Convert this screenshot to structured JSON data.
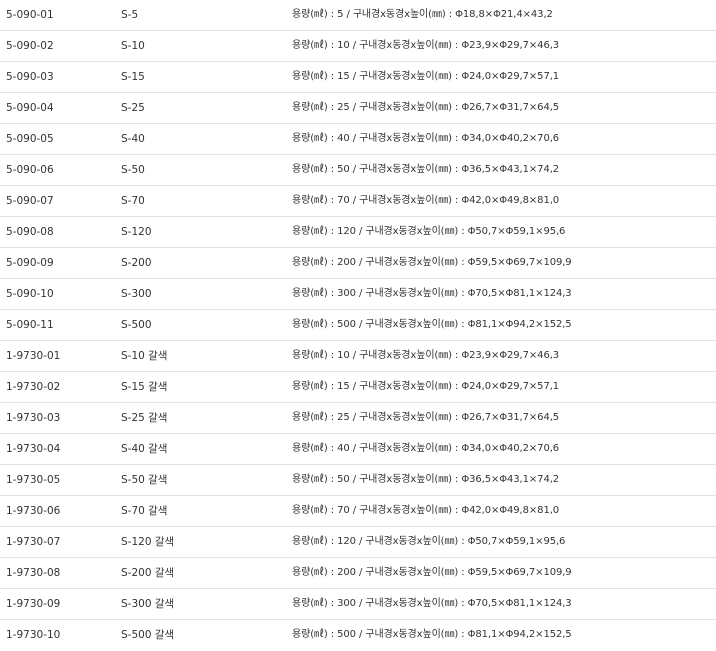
{
  "rows": [
    {
      "code": "5-090-01",
      "model": "S-5",
      "spec": "용량(㎖) : 5 / 구내경x동경x높이(㎜) : Φ18,8×Φ21,4×43,2"
    },
    {
      "code": "5-090-02",
      "model": "S-10",
      "spec": "용량(㎖) : 10 / 구내경x동경x높이(㎜) : Φ23,9×Φ29,7×46,3"
    },
    {
      "code": "5-090-03",
      "model": "S-15",
      "spec": "용량(㎖) : 15 / 구내경x동경x높이(㎜) : Φ24,0×Φ29,7×57,1"
    },
    {
      "code": "5-090-04",
      "model": "S-25",
      "spec": "용량(㎖) : 25 / 구내경x동경x높이(㎜) : Φ26,7×Φ31,7×64,5"
    },
    {
      "code": "5-090-05",
      "model": "S-40",
      "spec": "용량(㎖) : 40 / 구내경x동경x높이(㎜) : Φ34,0×Φ40,2×70,6"
    },
    {
      "code": "5-090-06",
      "model": "S-50",
      "spec": "용량(㎖) : 50 / 구내경x동경x높이(㎜) : Φ36,5×Φ43,1×74,2"
    },
    {
      "code": "5-090-07",
      "model": "S-70",
      "spec": "용량(㎖) : 70 / 구내경x동경x높이(㎜) : Φ42,0×Φ49,8×81,0"
    },
    {
      "code": "5-090-08",
      "model": "S-120",
      "spec": "용량(㎖) : 120 / 구내경x동경x높이(㎜) : Φ50,7×Φ59,1×95,6"
    },
    {
      "code": "5-090-09",
      "model": "S-200",
      "spec": "용량(㎖) : 200 / 구내경x동경x높이(㎜) : Φ59,5×Φ69,7×109,9"
    },
    {
      "code": "5-090-10",
      "model": "S-300",
      "spec": "용량(㎖) : 300 / 구내경x동경x높이(㎜) : Φ70,5×Φ81,1×124,3"
    },
    {
      "code": "5-090-11",
      "model": "S-500",
      "spec": "용량(㎖) : 500 / 구내경x동경x높이(㎜) : Φ81,1×Φ94,2×152,5"
    },
    {
      "code": "1-9730-01",
      "model": "S-10 갈색",
      "spec": "용량(㎖) : 10 / 구내경x동경x높이(㎜) : Φ23,9×Φ29,7×46,3"
    },
    {
      "code": "1-9730-02",
      "model": "S-15 갈색",
      "spec": "용량(㎖) : 15 / 구내경x동경x높이(㎜) : Φ24,0×Φ29,7×57,1"
    },
    {
      "code": "1-9730-03",
      "model": "S-25 갈색",
      "spec": "용량(㎖) : 25 / 구내경x동경x높이(㎜) : Φ26,7×Φ31,7×64,5"
    },
    {
      "code": "1-9730-04",
      "model": "S-40 갈색",
      "spec": "용량(㎖) : 40 / 구내경x동경x높이(㎜) : Φ34,0×Φ40,2×70,6"
    },
    {
      "code": "1-9730-05",
      "model": "S-50 갈색",
      "spec": "용량(㎖) : 50 / 구내경x동경x높이(㎜) : Φ36,5×Φ43,1×74,2"
    },
    {
      "code": "1-9730-06",
      "model": "S-70 갈색",
      "spec": "용량(㎖) : 70 / 구내경x동경x높이(㎜) : Φ42,0×Φ49,8×81,0"
    },
    {
      "code": "1-9730-07",
      "model": "S-120 갈색",
      "spec": "용량(㎖) : 120 / 구내경x동경x높이(㎜) : Φ50,7×Φ59,1×95,6"
    },
    {
      "code": "1-9730-08",
      "model": "S-200 갈색",
      "spec": "용량(㎖) : 200 / 구내경x동경x높이(㎜) : Φ59,5×Φ69,7×109,9"
    },
    {
      "code": "1-9730-09",
      "model": "S-300 갈색",
      "spec": "용량(㎖) : 300 / 구내경x동경x높이(㎜) : Φ70,5×Φ81,1×124,3"
    },
    {
      "code": "1-9730-10",
      "model": "S-500 갈색",
      "spec": "용량(㎖) : 500 / 구내경x동경x높이(㎜) : Φ81,1×Φ94,2×152,5"
    }
  ]
}
